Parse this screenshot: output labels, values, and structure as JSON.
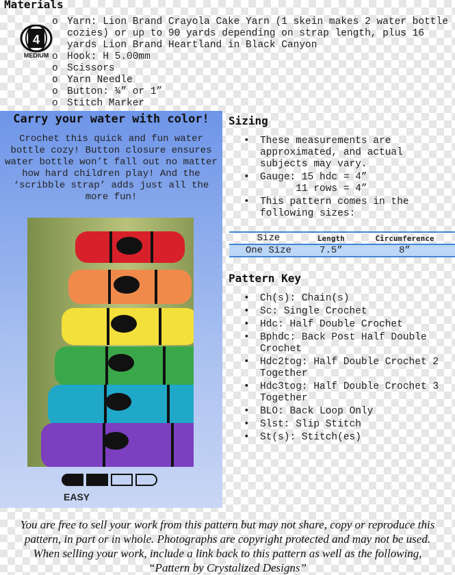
{
  "materials": {
    "title": "Materials",
    "yarn_weight_number": "4",
    "yarn_weight_label": "MEDIUM",
    "bullet": "o",
    "items": [
      "Yarn: Lion Brand Crayola Cake Yarn (1 skein makes 2 water bottle cozies) or up to 90 yards depending on strap length, plus 16 yards Lion Brand Heartland in Black Canyon",
      "Hook: H 5.00mm",
      "Scissors",
      "Yarn Needle",
      "Button: ¾” or 1”",
      "Stitch Marker"
    ]
  },
  "promo": {
    "title": "Carry your water with color!",
    "text": "Crochet this quick and fun water bottle cozy! Button closure ensures water bottle won’t fall out no matter how hard children play! And the ‘scribble strap’ adds just all the more fun!",
    "difficulty": "EASY",
    "difficulty_level": 2,
    "difficulty_max": 4,
    "cozy_colors": [
      "#d8202a",
      "#f08a4b",
      "#f3e03a",
      "#3aa84a",
      "#1fa8c8",
      "#7b3fbf"
    ]
  },
  "sizing": {
    "title": "Sizing",
    "items": [
      "These measurements are approximated, and actual subjects may vary.",
      "Gauge: 15 hdc = 4”\n      11 rows = 4”",
      "This pattern comes in the following sizes:"
    ],
    "table": {
      "headers": [
        "Size",
        "Length",
        "Circumference"
      ],
      "row": [
        "One Size",
        "7.5”",
        "8”"
      ]
    }
  },
  "key": {
    "title": "Pattern Key",
    "items": [
      "Ch(s): Chain(s)",
      "Sc: Single Crochet",
      "Hdc: Half Double Crochet",
      "Bphdc: Back Post Half Double Crochet",
      "Hdc2tog: Half Double Crochet 2 Together",
      "Hdc3tog: Half Double Crochet 3 Together",
      "BLO: Back Loop Only",
      "Slst: Slip Stitch",
      "St(s): Stitch(es)"
    ]
  },
  "footer": "You are free to sell your work from this pattern but may not share, copy or reproduce this pattern, in part or in whole. Photographs are copyright protected and may not be used. When selling your work, include a link back to this pattern as well as the following, “Pattern by Crystalized Designs”"
}
